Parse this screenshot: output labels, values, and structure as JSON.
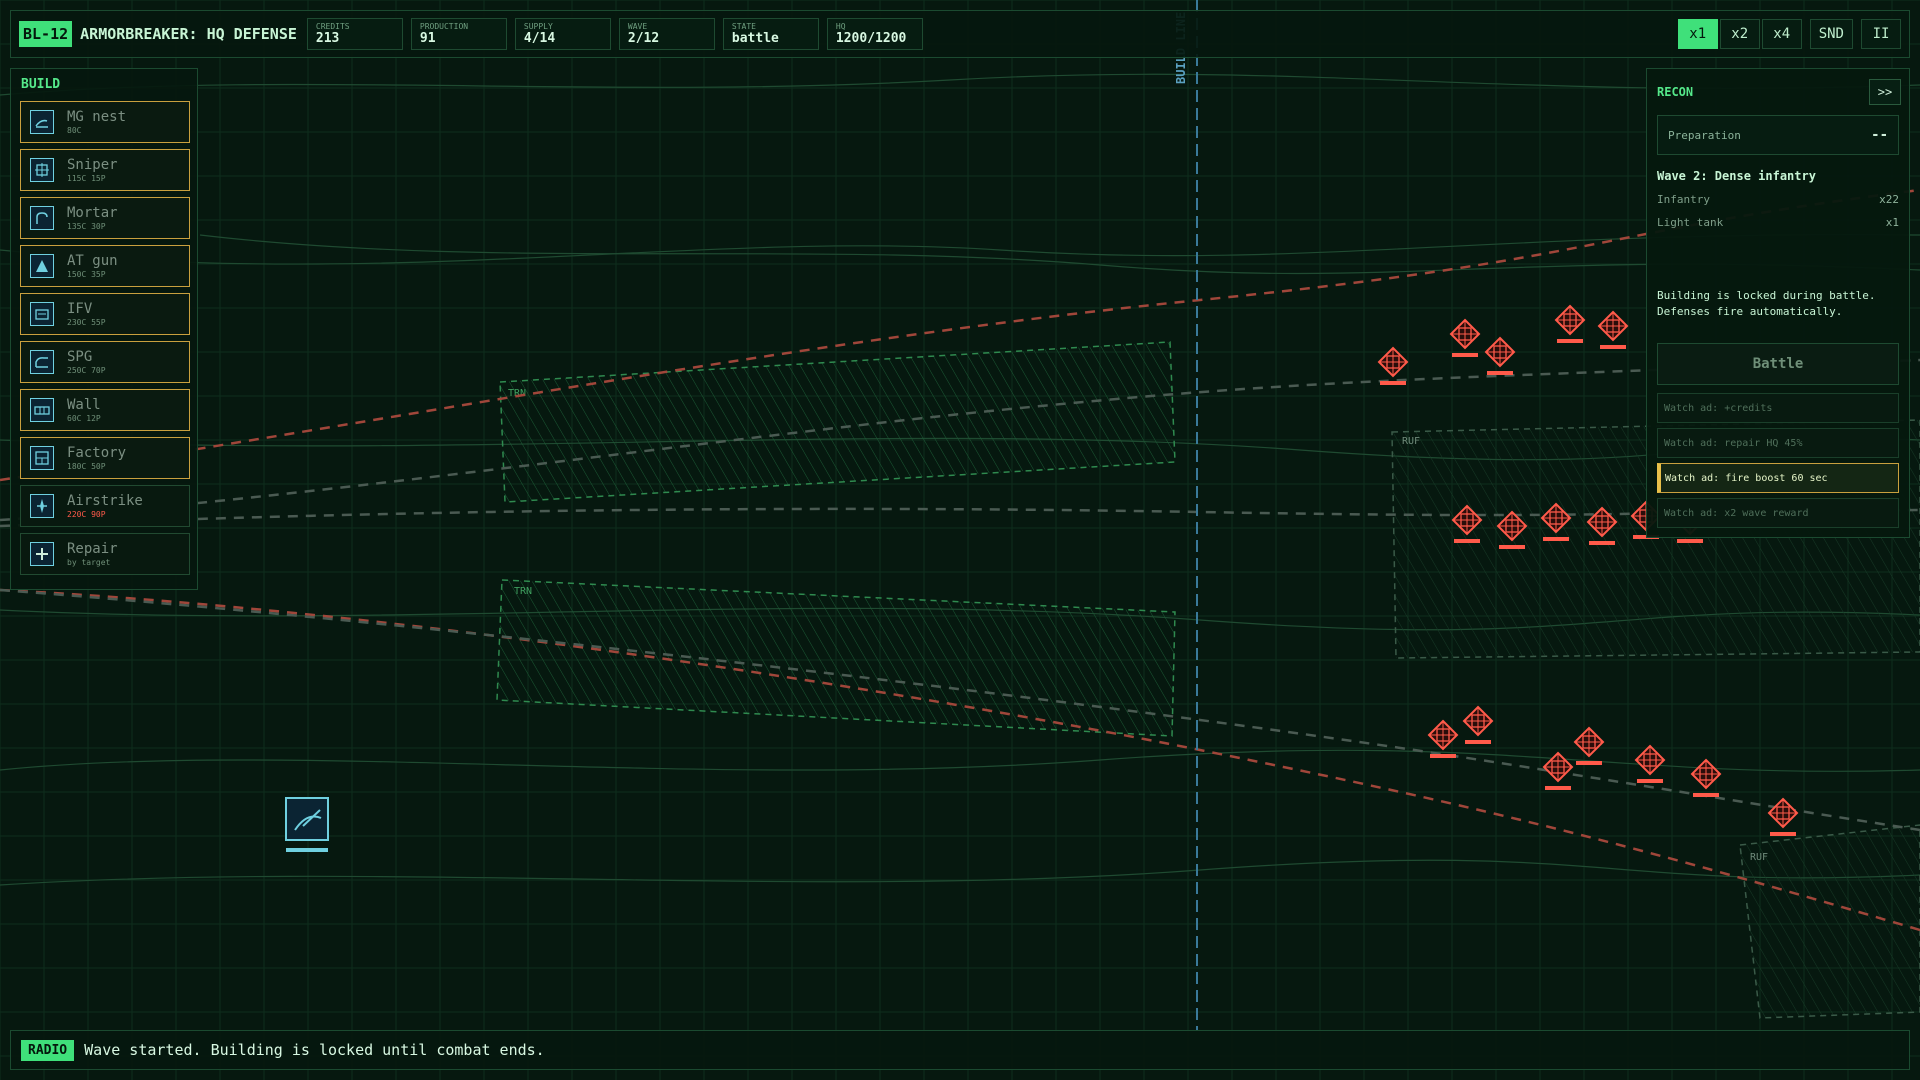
{
  "mission": {
    "tag": "BL-12",
    "title": "ARMORBREAKER: HQ DEFENSE"
  },
  "stats": [
    {
      "label": "CREDITS",
      "value": "213"
    },
    {
      "label": "PRODUCTION",
      "value": "91"
    },
    {
      "label": "SUPPLY",
      "value": "4/14"
    },
    {
      "label": "WAVE",
      "value": "2/12"
    },
    {
      "label": "STATE",
      "value": "battle"
    },
    {
      "label": "HQ",
      "value": "1200/1200"
    }
  ],
  "controls": {
    "x1": "x1",
    "x2": "x2",
    "x4": "x4",
    "sound": "SND",
    "pause": "II"
  },
  "build": {
    "title": "BUILD",
    "items": [
      {
        "name": "MG nest",
        "cost": "80C",
        "icon": "mg-nest-icon"
      },
      {
        "name": "Sniper",
        "cost": "115C 15P",
        "icon": "sniper-icon"
      },
      {
        "name": "Mortar",
        "cost": "135C 30P",
        "icon": "mortar-icon"
      },
      {
        "name": "AT gun",
        "cost": "150C 35P",
        "icon": "at-gun-icon"
      },
      {
        "name": "IFV",
        "cost": "230C 55P",
        "icon": "ifv-icon"
      },
      {
        "name": "SPG",
        "cost": "250C 70P",
        "icon": "spg-icon"
      },
      {
        "name": "Wall",
        "cost": "60C 12P",
        "icon": "wall-icon"
      },
      {
        "name": "Factory",
        "cost": "180C 50P",
        "icon": "factory-icon"
      },
      {
        "name": "Airstrike",
        "cost": "220C 90P",
        "icon": "airstrike-icon"
      },
      {
        "name": "Repair",
        "cost": "by target",
        "icon": "repair-icon"
      }
    ]
  },
  "recon": {
    "title": "RECON",
    "collapse_label": ">>",
    "phase_label": "Preparation",
    "phase_timer": "--",
    "wave_name": "Wave 2: Dense infantry",
    "enemies": [
      {
        "name": "Infantry",
        "count": "x22"
      },
      {
        "name": "Light tank",
        "count": "x1"
      }
    ],
    "note_line1": "Building is locked during battle.",
    "note_line2": "Defenses fire automatically.",
    "battle_label": "Battle",
    "ads": [
      {
        "label": "Watch ad: +credits"
      },
      {
        "label": "Watch ad: repair HQ 45%"
      },
      {
        "label": "Watch ad: fire boost 60 sec"
      },
      {
        "label": "Watch ad: x2 wave reward"
      }
    ]
  },
  "map": {
    "build_line_label": "BUILD LINE",
    "trn_label": "TRN",
    "ruf_label": "RUF"
  },
  "radio": {
    "tag": "RADIO",
    "message": "Wave started. Building is locked until combat ends."
  },
  "colors": {
    "accent": "#3fe07a",
    "enemy": "#ff5a4a",
    "friendly": "#6fd0e0",
    "gold": "#c9a03e"
  }
}
